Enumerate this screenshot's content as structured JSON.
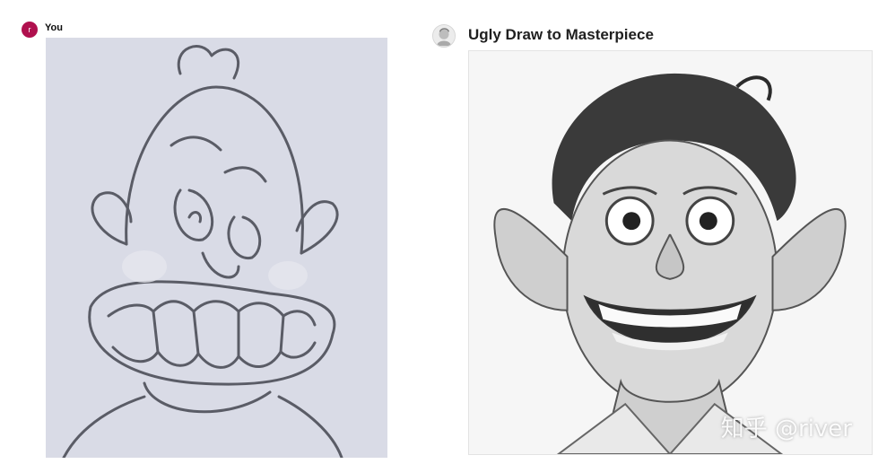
{
  "user_message": {
    "avatar_initial": "r",
    "avatar_color": "#b0104e",
    "author": "You"
  },
  "assistant_message": {
    "author": "Ugly Draw to Masterpiece",
    "avatar_icon": "gpt-profile-icon"
  },
  "watermark": "知乎 @river"
}
